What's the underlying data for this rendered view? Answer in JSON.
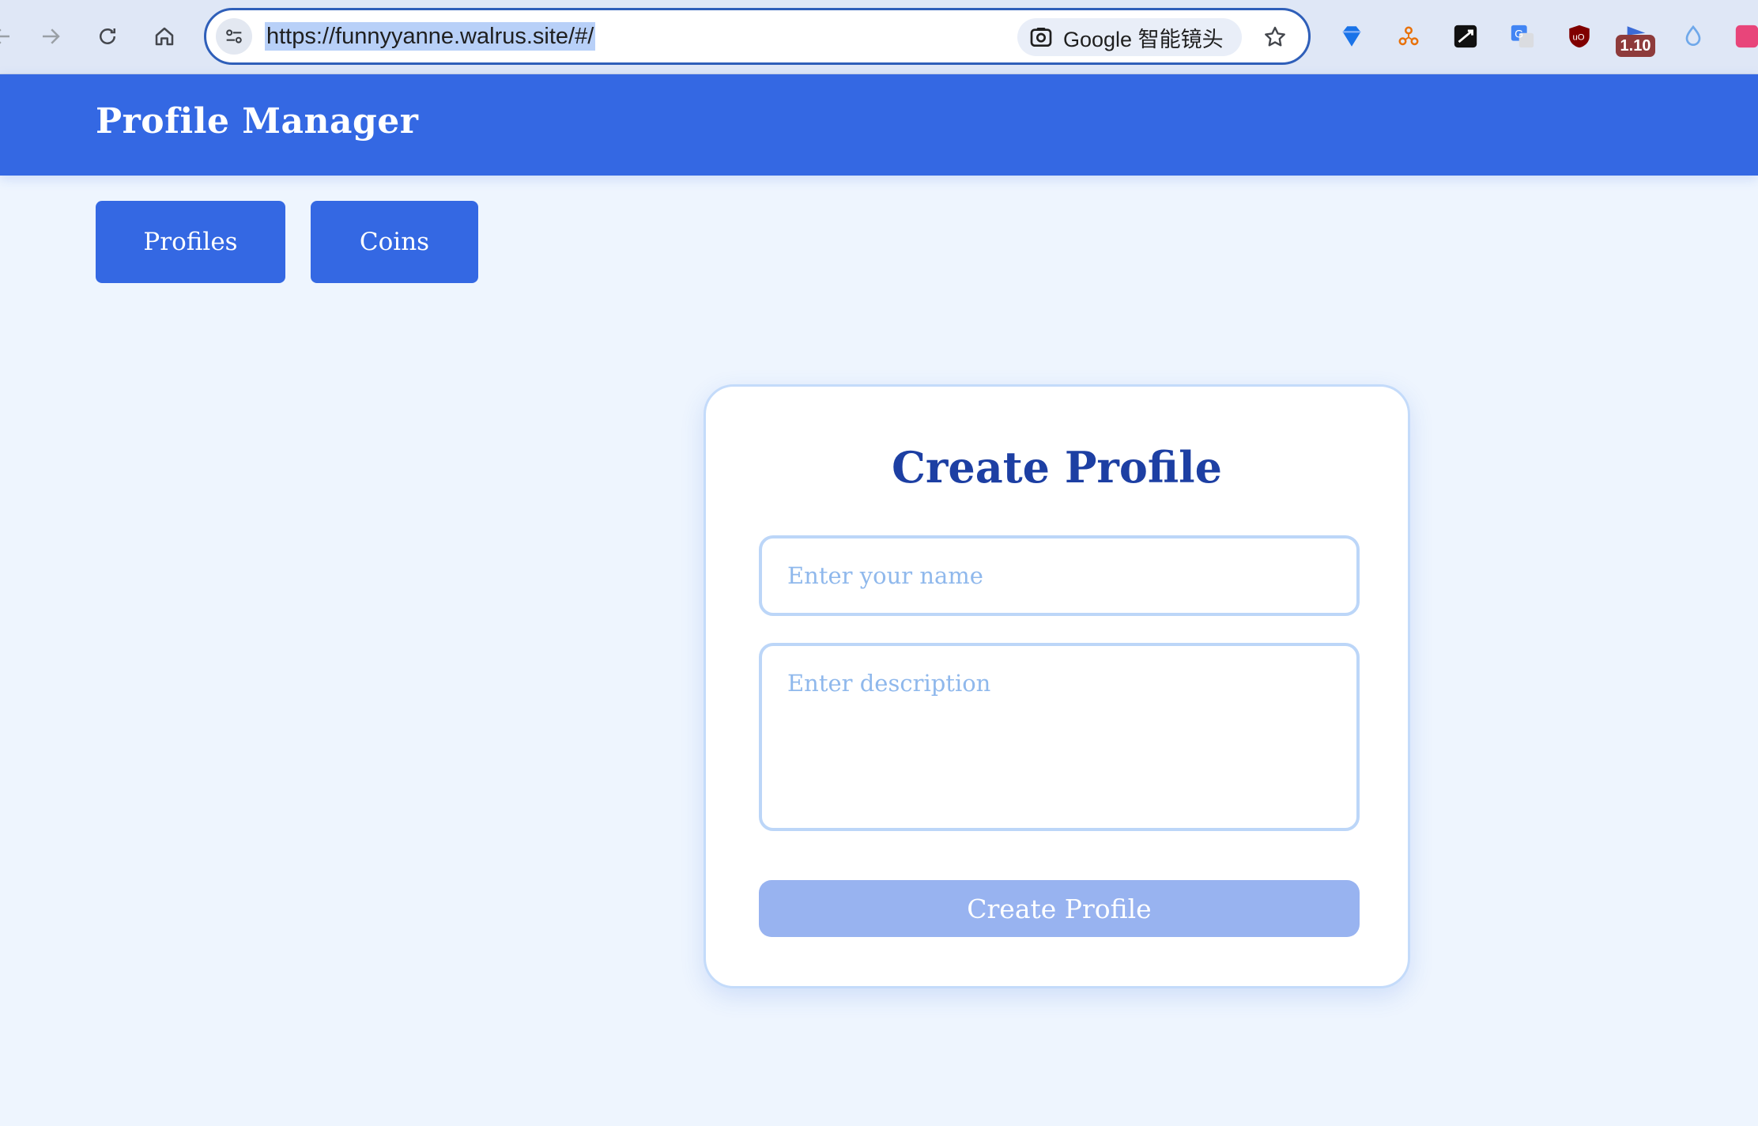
{
  "browser": {
    "url": "https://funnyyanne.walrus.site/#/",
    "lens_label": "Google 智能镜头",
    "extensions": [
      {
        "icon": "diamond-icon",
        "color": "#1a73e8"
      },
      {
        "icon": "network-icon",
        "color": "#e8710a"
      },
      {
        "icon": "dictionary-icon",
        "color": "#111111"
      },
      {
        "icon": "translate-icon",
        "color": "#4285f4"
      },
      {
        "icon": "ublock-icon",
        "color": "#800000"
      },
      {
        "icon": "flag-icon",
        "color": "#3b6bd6"
      },
      {
        "icon": "droplet-icon",
        "color": "#6fa8ea"
      },
      {
        "icon": "chinese-translate-icon",
        "color": "#e8457a"
      }
    ],
    "extension_badge": "1.10"
  },
  "app": {
    "title": "Profile Manager",
    "accent": "#3468e3"
  },
  "nav": {
    "profiles_label": "Profiles",
    "coins_label": "Coins"
  },
  "form": {
    "title": "Create Profile",
    "name_placeholder": "Enter your name",
    "description_placeholder": "Enter description",
    "submit_label": "Create Profile"
  }
}
